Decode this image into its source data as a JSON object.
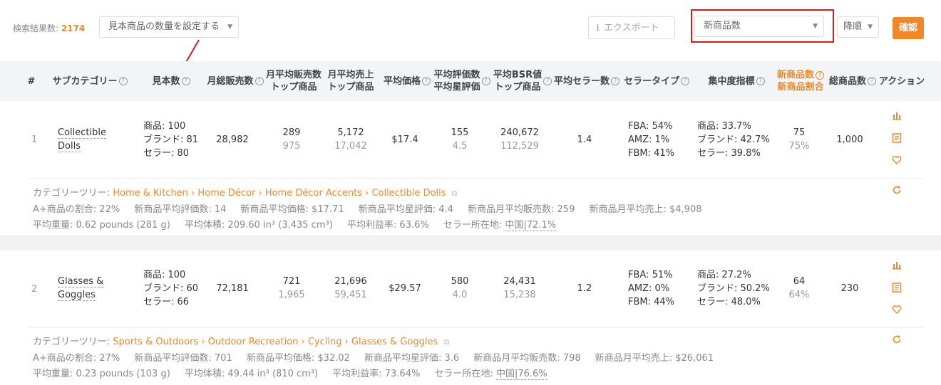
{
  "toolbar": {
    "result_label": "検索結果数:",
    "result_count": "2174",
    "sample_select_placeholder": "見本商品の数量を設定する",
    "export_label": "エクスポート",
    "sort_field_value": "新商品数",
    "sort_order_value": "降順",
    "confirm_label": "確認"
  },
  "colors": {
    "accent": "#f0882a",
    "highlight_box": "#e0191b",
    "header_bg": "#f3f4f6"
  },
  "columns": {
    "index": "#",
    "subcategory": "サブカテゴリー",
    "sample": "見本数",
    "monthly_sales": "月総販売数",
    "avg_sales_l1": "月平均販売数",
    "avg_sales_l2": "トップ商品",
    "avg_revenue_l1": "月平均売上",
    "avg_revenue_l2": "トップ商品",
    "avg_price": "平均価格",
    "ratings_l1": "平均評価数",
    "ratings_l2": "平均星評価",
    "bsr_l1": "平均BSR値",
    "bsr_l2": "トップ商品",
    "avg_sellers": "平均セラー数",
    "seller_type": "セラータイプ",
    "concentration": "集中度指標",
    "new_count_l1": "新商品数",
    "new_count_l2": "新商品割合",
    "total": "総商品数",
    "action": "アクション"
  },
  "rows": [
    {
      "index": "1",
      "category_l1": "Collectible",
      "category_l2": "Dolls",
      "sample_products": "商品: 100",
      "sample_brands": "ブランド: 81",
      "sample_sellers": "セラー: 80",
      "monthly_sales": "28,982",
      "avg_sales": "289",
      "avg_sales_top": "975",
      "avg_revenue": "5,172",
      "avg_revenue_top": "17,042",
      "avg_price": "$17.4",
      "ratings": "155",
      "stars": "4.5",
      "bsr": "240,672",
      "bsr_top": "112,529",
      "avg_sellers": "1.4",
      "fba": "FBA: 54%",
      "amz": "AMZ: 1%",
      "fbm": "FBM: 41%",
      "conc_products": "商品: 33.7%",
      "conc_brands": "ブランド: 42.7%",
      "conc_sellers": "セラー: 39.8%",
      "new_count": "75",
      "new_ratio": "75%",
      "total": "1,000",
      "tree_label": "カテゴリーツリー:",
      "tree_path": "Home & Kitchen › Home Décor › Home Décor Accents › Collectible Dolls",
      "aplus": "A+商品の割合: 22%",
      "new_ratings": "新商品平均評価数: 14",
      "new_price": "新商品平均価格: $17.71",
      "new_stars": "新商品平均星評価: 4.4",
      "new_sales": "新商品月平均販売数: 259",
      "new_revenue": "新商品月平均売上: $4,908",
      "weight": "平均重量: 0.62 pounds (281 g)",
      "volume": "平均体積: 209.60 in³ (3,435 cm³)",
      "margin": "平均利益率: 63.6%",
      "seller_loc_label": "セラー所在地:",
      "seller_loc_value": "中国|72.1%"
    },
    {
      "index": "2",
      "category_l1": "Glasses &",
      "category_l2": "Goggles",
      "sample_products": "商品: 100",
      "sample_brands": "ブランド: 60",
      "sample_sellers": "セラー: 66",
      "monthly_sales": "72,181",
      "avg_sales": "721",
      "avg_sales_top": "1,965",
      "avg_revenue": "21,696",
      "avg_revenue_top": "59,451",
      "avg_price": "$29.57",
      "ratings": "580",
      "stars": "4.0",
      "bsr": "24,431",
      "bsr_top": "15,238",
      "avg_sellers": "1.2",
      "fba": "FBA: 51%",
      "amz": "AMZ: 0%",
      "fbm": "FBM: 44%",
      "conc_products": "商品: 27.2%",
      "conc_brands": "ブランド: 50.2%",
      "conc_sellers": "セラー: 48.0%",
      "new_count": "64",
      "new_ratio": "64%",
      "total": "230",
      "tree_label": "カテゴリーツリー:",
      "tree_path": "Sports & Outdoors › Outdoor Recreation › Cycling › Glasses & Goggles",
      "aplus": "A+商品の割合: 27%",
      "new_ratings": "新商品平均評価数: 701",
      "new_price": "新商品平均価格: $32.02",
      "new_stars": "新商品平均星評価: 3.6",
      "new_sales": "新商品月平均販売数: 798",
      "new_revenue": "新商品月平均売上: $26,061",
      "weight": "平均重量: 0.23 pounds (103 g)",
      "volume": "平均体積: 49.44 in³ (810 cm³)",
      "margin": "平均利益率: 73.64%",
      "seller_loc_label": "セラー所在地:",
      "seller_loc_value": "中国|76.6%"
    }
  ]
}
